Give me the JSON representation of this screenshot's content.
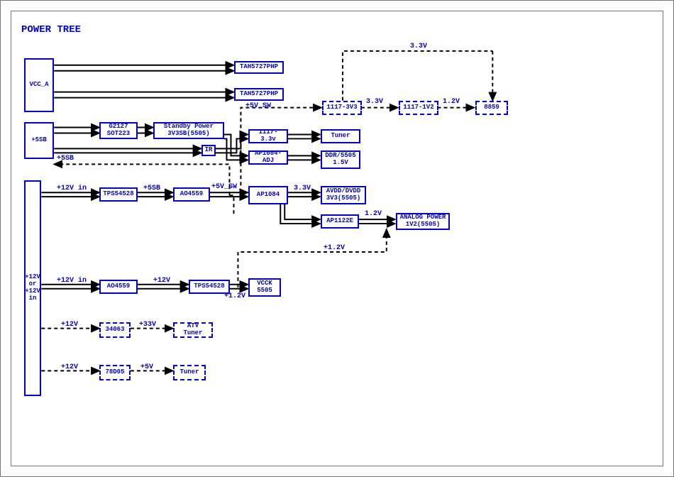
{
  "title": "POWER TREE",
  "blocks": {
    "vcc_a": "VCC_A",
    "p5sb": "+5SB",
    "p12v_or": "+12V\nor\n+12V in",
    "g2127": "G2127\nSOT223",
    "stdby": "Standby Power\n3V3SB(5505)",
    "ir": "IR",
    "tah_top": "TAH5727PHP",
    "tah_bot": "TAH5727PHP",
    "tps_a": "TPS54528",
    "ao_a": "AO4559",
    "ap1084": "AP1084",
    "avdd": "AVDD/DVDD\n3V3(5505)",
    "ap1122e": "AP1122E",
    "analog_pwr": "ANALOG POWER\n1V2(5505)",
    "r1117_33v": "1117-3.3v",
    "tuner_a": "Tuner",
    "ap1084adj": "AP1084-ADJ",
    "ddr5505": "DDR/5505\n1.5V",
    "d1117_3v3": "1117-3V3",
    "d1117_1v2": "1117-1V2",
    "d8859": "8859",
    "ao_b": "AO4559",
    "tps_b": "TPS54528",
    "vcck": "VCCK\n5505",
    "d34063": "34063",
    "datv": "ATV Tuner",
    "d78d05": "78D05",
    "dtuner": "Tuner"
  },
  "labels": {
    "l5v_sw_top": "+5V_SW",
    "l33v_top": "3.3V",
    "l12v_top": "1.2V",
    "l33v_topmost": "3.3V",
    "l5sb_a": "+5SB",
    "l12vin_a": "+12V in",
    "l5sb_b": "+5SB",
    "l5v_sw_mid": "+5V_SW",
    "l33v_mid": "3.3V",
    "l12v_mid": "1.2V",
    "l12v_loop": "+1.2V",
    "l12vin_b": "+12V in",
    "l12v_b": "+12V",
    "l12v_c": "+1.2V",
    "l12v_d1": "+12V",
    "l33v_d": "+33V",
    "l12v_d2": "+12V",
    "l5v_d": "+5V"
  }
}
